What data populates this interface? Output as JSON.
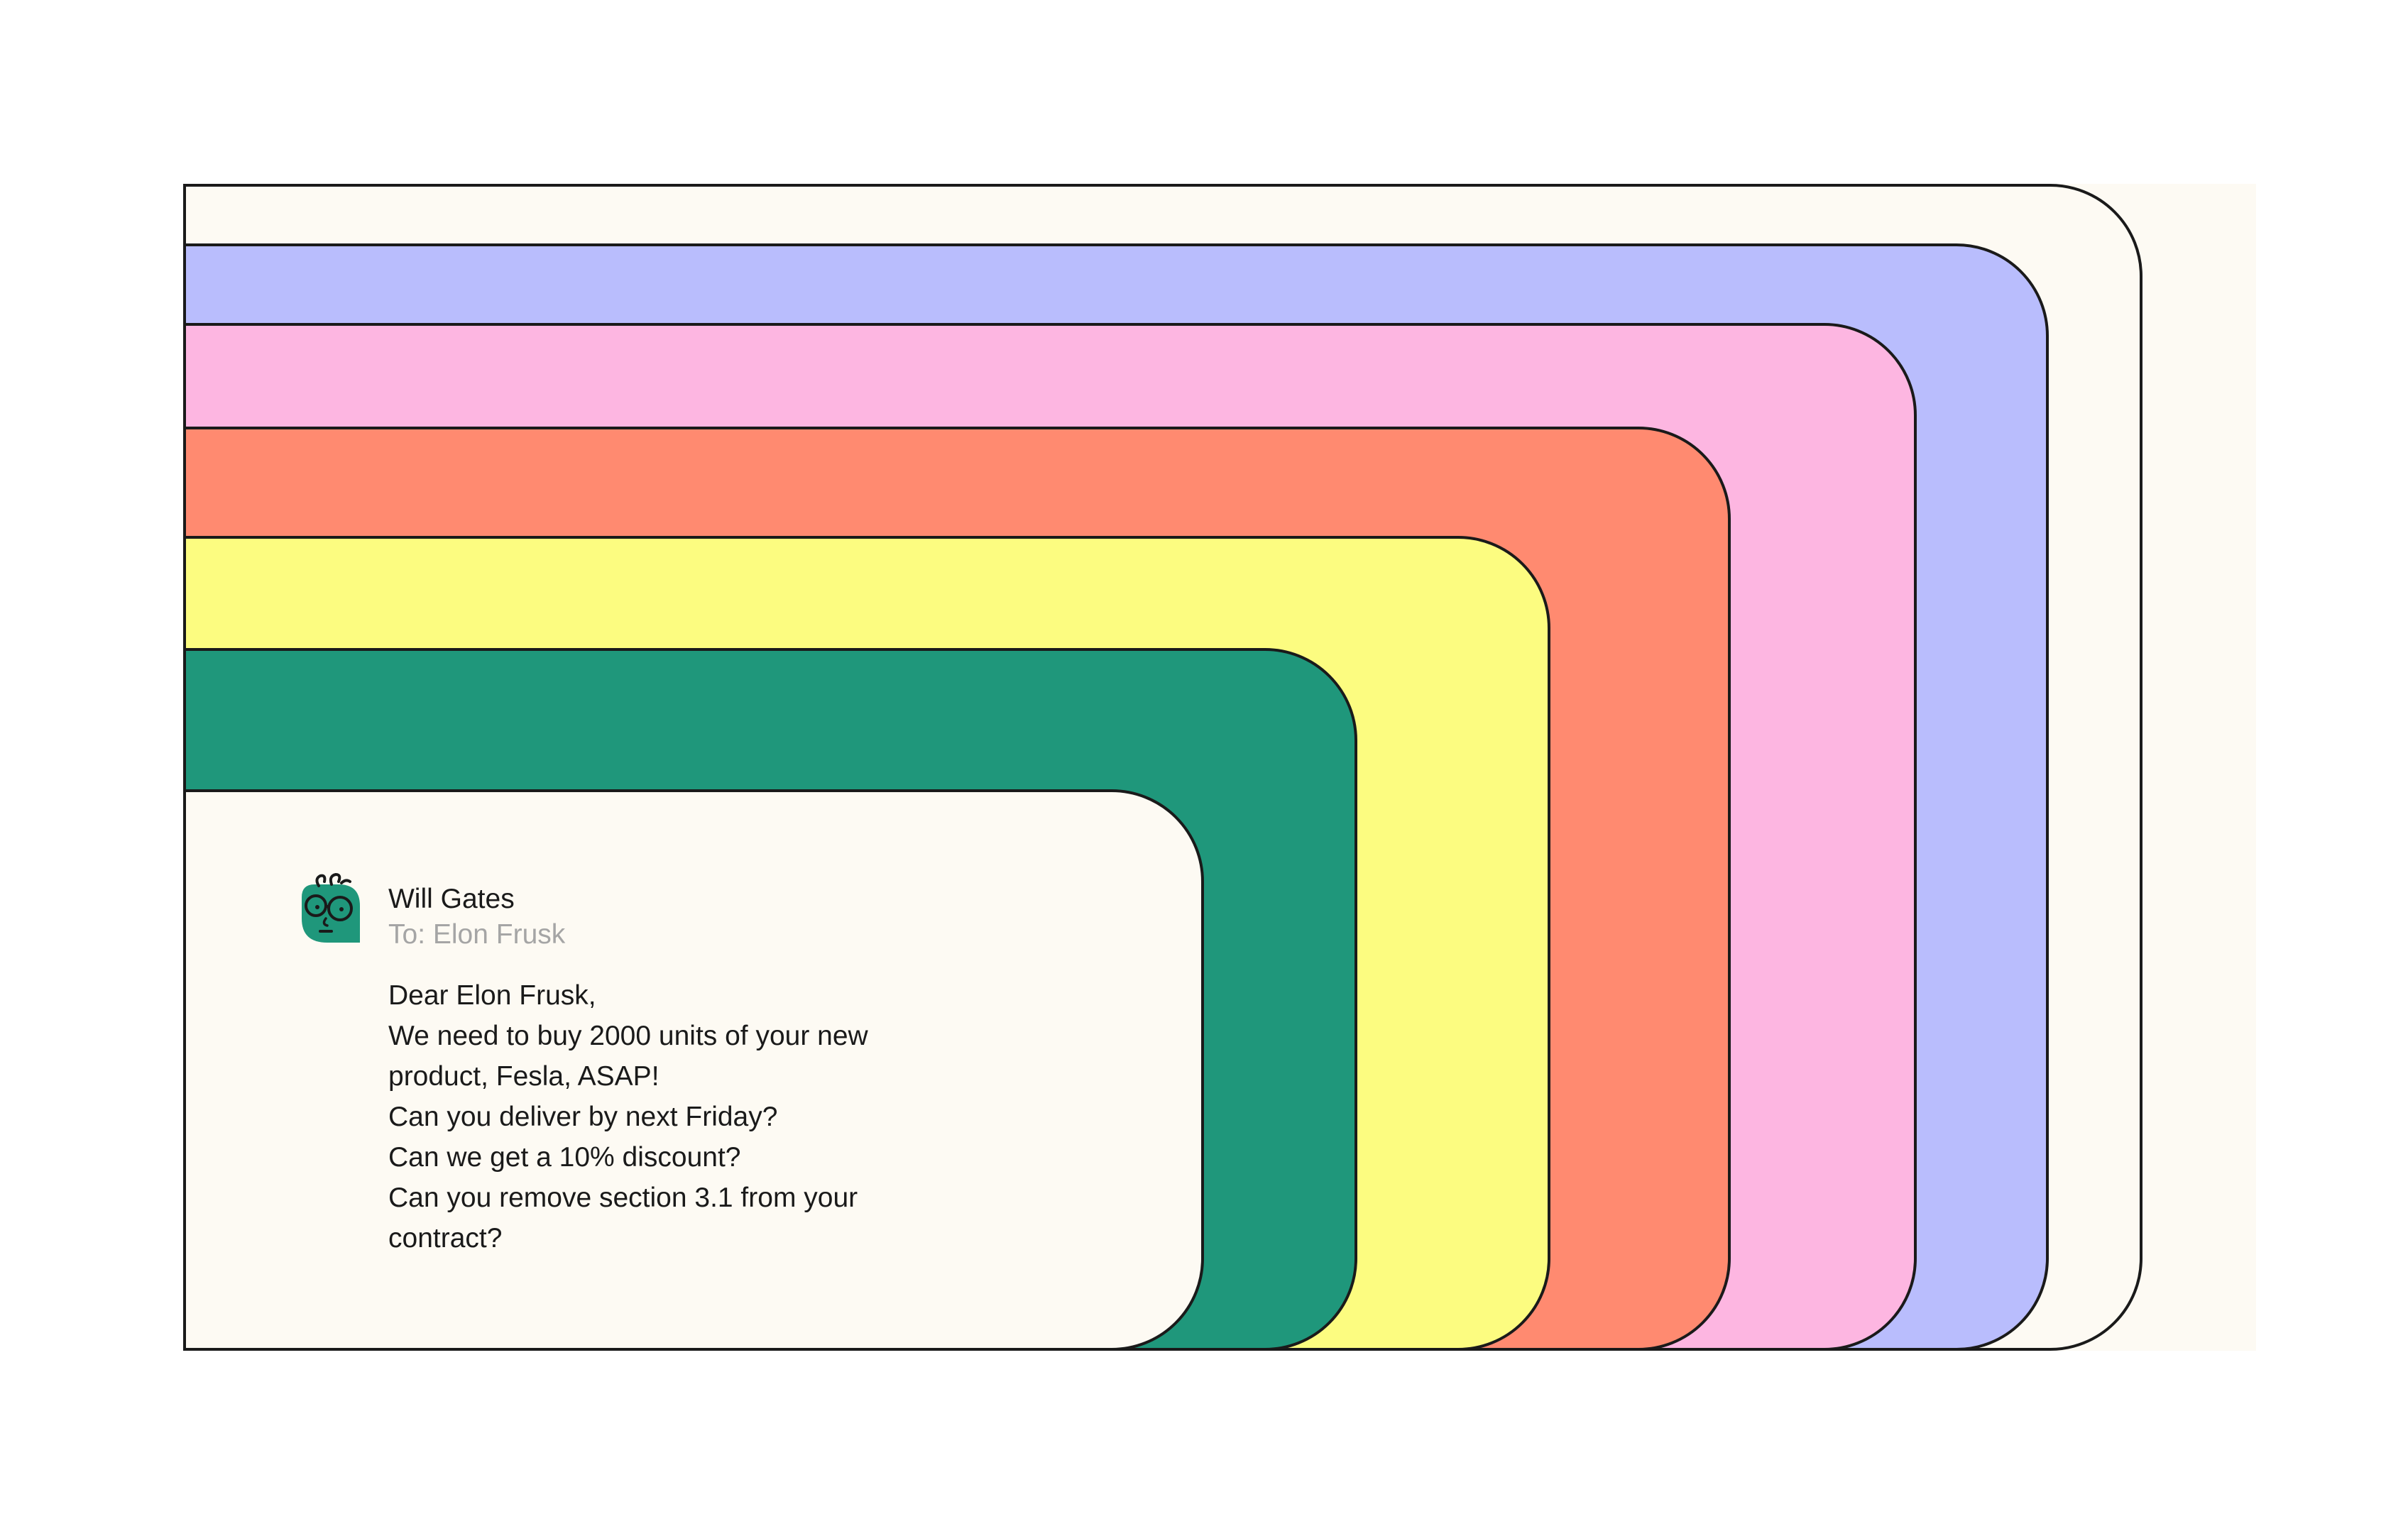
{
  "colors": {
    "backdrop": "#fdfaf3",
    "outline": "#1a1a1a",
    "layers": [
      "#fdfaf3",
      "#b9bdfd",
      "#fdb6e1",
      "#ff8a70",
      "#fcfc80",
      "#1f977b",
      "#fdfaf3"
    ],
    "avatar": "#1f977b"
  },
  "email": {
    "avatar_icon": "cartoon-face-with-glasses-icon",
    "sender": "Will Gates",
    "recipient": "To: Elon Frusk",
    "body_lines": [
      "Dear Elon Frusk,",
      "We need to buy 2000 units of your new",
      "product, Fesla, ASAP!",
      "Can you deliver by next Friday?",
      "Can we get a 10% discount?",
      "Can you remove section 3.1 from your",
      "contract?"
    ]
  }
}
